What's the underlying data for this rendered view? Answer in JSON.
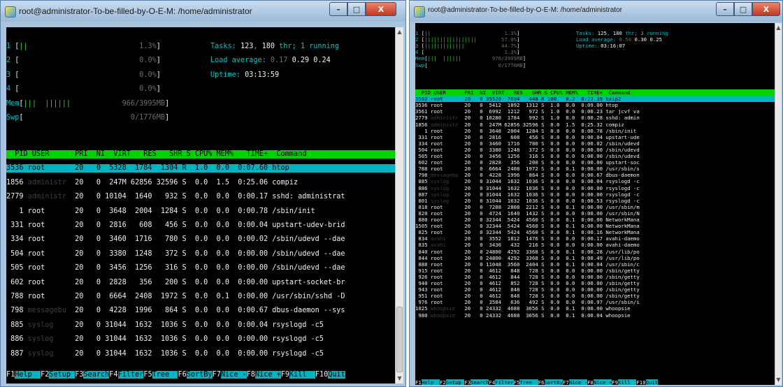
{
  "left": {
    "title": "root@administrator-To-be-filled-by-O-E-M: /home/administrator",
    "cpu": [
      {
        "num": "1",
        "bar": "||",
        "pct": "1.3%"
      },
      {
        "num": "2",
        "bar": "",
        "pct": "0.0%"
      },
      {
        "num": "3",
        "bar": "",
        "pct": "0.0%"
      },
      {
        "num": "4",
        "bar": "",
        "pct": "0.0%"
      }
    ],
    "mem": {
      "label": "Mem",
      "bar": "|||  ||||||",
      "value": "966/3995MB"
    },
    "swp": {
      "label": "Swp",
      "bar": "",
      "value": "0/1776MB"
    },
    "tasks": {
      "label": "Tasks: ",
      "v1": "123",
      "sep1": ", ",
      "v2": "180",
      "sep2": " thr; ",
      "v3": "1",
      "tail": " running"
    },
    "load": {
      "label": "Load average: ",
      "v1": "0.17",
      "v2": "0.29",
      "v3": "0.24"
    },
    "uptime": {
      "label": "Uptime: ",
      "value": "03:13:59"
    },
    "header": "  PID USER      PRI  NI  VIRT   RES   SHR S CPU% MEM%   TIME+  Command",
    "procs": [
      "3536 root       20   0  5328  1784  1304 R  1.0  0.0  0:07.60 htop",
      "1856 administr  20   0  247M 62856 32596 S  0.0  1.5  0:25.06 compiz",
      "2779 administr  20   0 10104  1640   932 S  0.0  0.0  0:00.17 sshd: administrat",
      "   1 root       20   0  3648  2004  1284 S  0.0  0.0  0:00.78 /sbin/init",
      " 331 root       20   0  2816   608   456 S  0.0  0.0  0:00.04 upstart-udev-brid",
      " 334 root       20   0  3460  1716   780 S  0.0  0.0  0:00.02 /sbin/udevd --dae",
      " 504 root       20   0  3380  1248   372 S  0.0  0.0  0:00.00 /sbin/udevd --dae",
      " 505 root       20   0  3456  1256   316 S  0.0  0.0  0:00.00 /sbin/udevd --dae",
      " 602 root       20   0  2828   356   200 S  0.0  0.0  0:00.00 upstart-socket-br",
      " 788 root       20   0  6664  2408  1972 S  0.0  0.1  0:00.00 /usr/sbin/sshd -D",
      " 798 messagebu  20   0  4228  1996   864 S  0.0  0.0  0:00.67 dbus-daemon --sys",
      " 885 syslog     20   0 31044  1632  1036 S  0.0  0.0  0:00.04 rsyslogd -c5",
      " 886 syslog     20   0 31044  1632  1036 S  0.0  0.0  0:00.00 rsyslogd -c5",
      " 887 syslog     20   0 31044  1632  1036 S  0.0  0.0  0:00.00 rsyslogd -c5"
    ],
    "fkeys": [
      {
        "key": "F1",
        "label": "Help  "
      },
      {
        "key": "F2",
        "label": "Setup "
      },
      {
        "key": "F3",
        "label": "Search"
      },
      {
        "key": "F4",
        "label": "Filter"
      },
      {
        "key": "F5",
        "label": "Tree  "
      },
      {
        "key": "F6",
        "label": "SortBy"
      },
      {
        "key": "F7",
        "label": "Nice -"
      },
      {
        "key": "F8",
        "label": "Nice +"
      },
      {
        "key": "F9",
        "label": "Kill  "
      },
      {
        "key": "F10",
        "label": "Quit"
      }
    ]
  },
  "right": {
    "title": "root@administrator-To-be-filled-by-O-E-M: /home/administrator",
    "cpu": [
      {
        "num": "1",
        "bar": "||",
        "pct": "1.3%"
      },
      {
        "num": "2",
        "bar": "|||||||||||||||||",
        "pct": "57.0%"
      },
      {
        "num": "3",
        "bar": "|||||||||||||",
        "pct": "44.7%"
      },
      {
        "num": "4",
        "bar": "",
        "pct": "1.3%"
      }
    ],
    "mem": {
      "label": "Mem",
      "bar": "|||  ||||||",
      "value": "976/3995MB"
    },
    "swp": {
      "label": "Swp",
      "bar": "",
      "value": "0/1776MB"
    },
    "tasks": {
      "label": "Tasks: ",
      "v1": "125",
      "sep1": ", ",
      "v2": "180",
      "sep2": " thr; ",
      "v3": "3",
      "tail": " running"
    },
    "load": {
      "label": "Load average: ",
      "v1": "0.50",
      "v2": "0.30",
      "v3": "0.25"
    },
    "uptime": {
      "label": "Uptime: ",
      "value": "03:16:07"
    },
    "header": "  PID USER      PRI  NI  VIRT   RES   SHR S CPU% MEM%   TIME+  Command",
    "procs": [
      "3562 root       20   0 35520  7684   448 R 100.  0.2  0:23.39 bzip2",
      "3536 root       20   0  5412  1892  1312 S  1.0  0.0  0:09.00 htop",
      "3561 root       20   0  6992  1212   972 S  1.0  0.0  0:00.23 tar jcvf va",
      "2779 administr  20   0 10280  1784   992 S  1.0  0.0  0:00.28 sshd: admin",
      "1856 administr  20   0  247M 62856 32596 S  0.0  1.5  0:25.32 compiz",
      "   1 root       20   0  3648  2004  1284 S  0.0  0.0  0:00.78 /sbin/init",
      " 331 root       20   0  2816   608   456 S  0.0  0.0  0:00.04 upstart-ude",
      " 334 root       20   0  3460  1716   780 S  0.0  0.0  0:00.02 /sbin/udevd",
      " 504 root       20   0  3380  1248   372 S  0.0  0.0  0:00.00 /sbin/udevd",
      " 505 root       20   0  3456  1256   316 S  0.0  0.0  0:00.00 /sbin/udevd",
      " 602 root       20   0  2828   356   200 S  0.0  0.0  0:00.00 upstart-soc",
      " 788 root       20   0  6664  2408  1972 S  0.0  0.1  0:00.00 /usr/sbin/s",
      " 798 messagebu  20   0  4228  1996   864 S  0.0  0.0  0:00.67 dbus-daemon",
      " 885 syslog     20   0 31044  1632  1036 S  0.0  0.0  0:00.04 rsyslogd -c",
      " 886 syslog     20   0 31044  1632  1036 S  0.0  0.0  0:00.00 rsyslogd -c",
      " 887 syslog     20   0 31044  1632  1036 S  0.0  0.0  0:00.00 rsyslogd -c",
      " 801 syslog     20   0 31044  1632  1036 S  0.0  0.0  0:00.53 rsyslogd -c",
      " 818 root       20   0  7208  2808  2212 S  0.0  0.1  0:00.00 /usr/sbin/m",
      " 820 root       20   0  4724  1640  1432 S  0.0  0.0  0:00.00 /usr/sbin/N",
      " 880 root       20   0 32344  5424  4560 S  0.0  0.1  0:00.00 NetworkMana",
      "1505 root       20   0 32344  5424  4560 S  0.0  0.1  0:00.00 NetworkMana",
      " 825 root       20   0 32344  5424  4560 S  0.0  0.1  0:00.16 NetworkMana",
      " 834 avahi      20   0  3552  1812  1476 S  0.0  0.0  0:00.17 avahi-daemo",
      " 835 avahi      20   0  3436   432   216 S  0.0  0.0  0:00.00 avahi-daemo",
      " 840 root       20   0 24800  4292  3368 S  0.0  0.1  0:00.28 /usr/lib/po",
      " 844 root       20   0 24800  4292  3368 S  0.0  0.1  0:00.49 /usr/lib/po",
      " 888 root       20   0 11048  3560  2404 S  0.0  0.1  0:00.04 /usr/sbin/c",
      " 915 root       20   0  4612   848   728 S  0.0  0.0  0:00.00 /sbin/getty",
      " 926 root       20   0  4612   844   728 S  0.0  0.0  0:00.00 /sbin/getty",
      " 940 root       20   0  4612   852   728 S  0.0  0.0  0:00.00 /sbin/getty",
      " 943 root       20   0  4612   848   728 S  0.0  0.0  0:00.00 /sbin/getty",
      " 951 root       20   0  4612   848   728 S  0.0  0.0  0:00.00 /sbin/getty",
      " 976 root       20   0  3584   636   492 S  0.0  0.0  0:00.97 /usr/sbin/i",
      "1025 whoopsie   20   0 24332  4688  3656 S  0.0  0.1  0:00.00 whoopsie",
      " 980 whoopsie   20   0 24332  4688  3656 S  0.0  0.1  0:00.04 whoopsie"
    ],
    "fkeys": [
      {
        "key": "F1",
        "label": "Help  "
      },
      {
        "key": "F2",
        "label": "Setup "
      },
      {
        "key": "F3",
        "label": "Search"
      },
      {
        "key": "F4",
        "label": "Filter"
      },
      {
        "key": "F5",
        "label": "Tree  "
      },
      {
        "key": "F6",
        "label": "SortBy"
      },
      {
        "key": "F7",
        "label": "Nice -"
      },
      {
        "key": "F8",
        "label": "Nice +"
      },
      {
        "key": "F9",
        "label": "Kill  "
      },
      {
        "key": "F10",
        "label": "Quit"
      }
    ]
  },
  "window_controls": {
    "minimize": "–",
    "maximize": "□",
    "close": "X"
  },
  "colors": {
    "header_bg": "#00d200",
    "selected_bg": "#00b4c4",
    "terminal_bg": "#000000"
  }
}
